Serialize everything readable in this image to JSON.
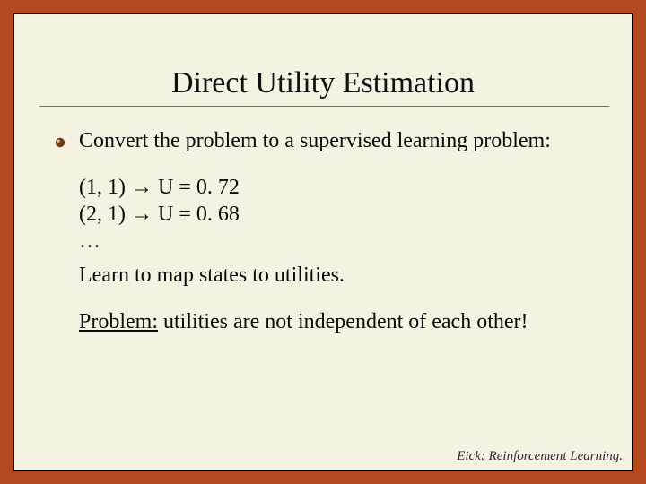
{
  "title": "Direct Utility Estimation",
  "intro": "Convert the problem to a supervised learning problem:",
  "examples": {
    "row1_state": "(1, 1)",
    "row1_util": "U = 0. 72",
    "row2_state": "(2, 1)",
    "row2_util": "U = 0. 68",
    "ellipsis": "…",
    "arrow": "→"
  },
  "learn": "Learn to map states to utilities.",
  "problem_label": "Problem:",
  "problem_text": " utilities are not independent of each other!",
  "footer": "Eick: Reinforcement Learning."
}
